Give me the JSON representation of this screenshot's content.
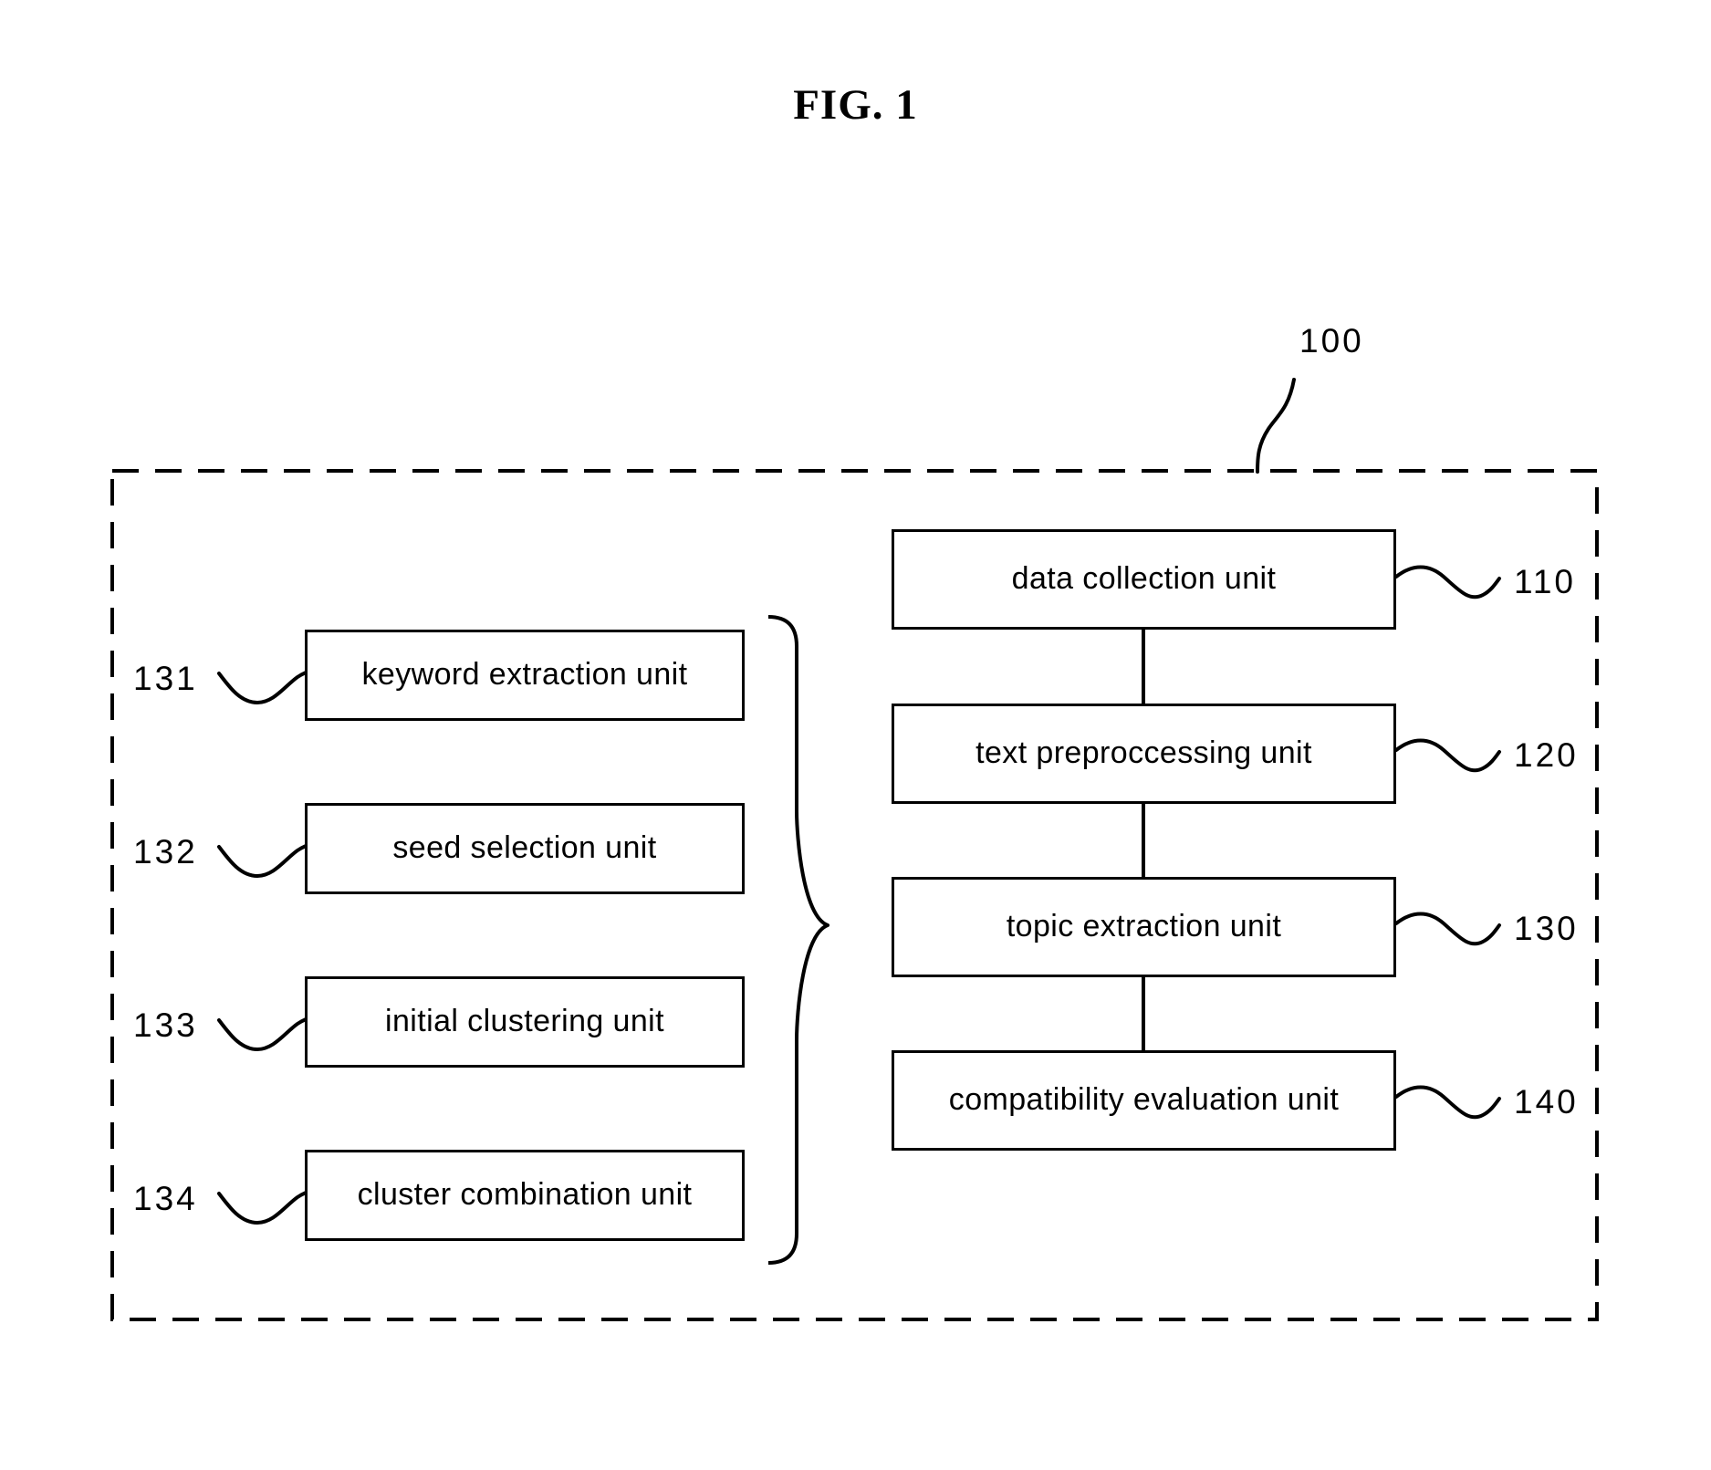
{
  "figure": {
    "title": "FIG. 1",
    "system_ref": "100"
  },
  "pipeline": {
    "blocks": [
      {
        "label": "data collection unit",
        "ref": "110"
      },
      {
        "label": "text preproccessing unit",
        "ref": "120"
      },
      {
        "label": "topic extraction unit",
        "ref": "130"
      },
      {
        "label": "compatibility evaluation unit",
        "ref": "140"
      }
    ]
  },
  "subunits": {
    "blocks": [
      {
        "label": "keyword extraction unit",
        "ref": "131"
      },
      {
        "label": "seed selection unit",
        "ref": "132"
      },
      {
        "label": "initial clustering unit",
        "ref": "133"
      },
      {
        "label": "cluster combination unit",
        "ref": "134"
      }
    ]
  },
  "colors": {
    "line": "#000000",
    "background": "#ffffff"
  }
}
